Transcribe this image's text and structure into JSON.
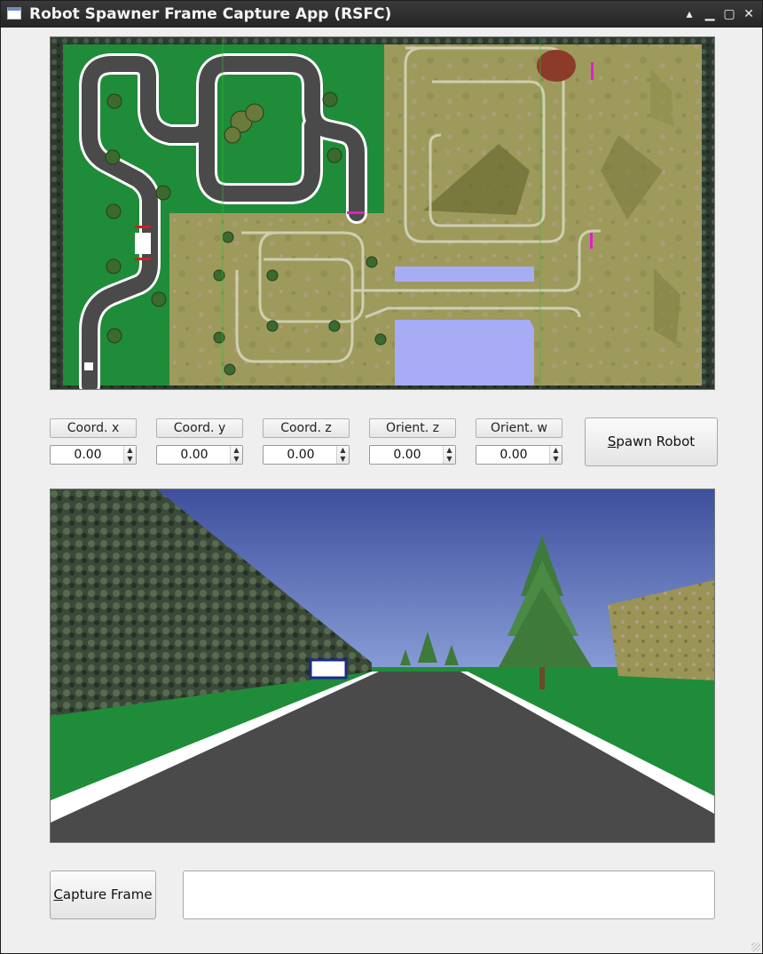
{
  "window": {
    "title": "Robot Spawner Frame Capture App (RSFC)",
    "controls": {
      "minimize": "▁",
      "maximize": "▢",
      "close": "✕",
      "up": "▴"
    }
  },
  "views": {
    "top_view_name": "top-down simulation map",
    "camera_view_name": "robot front camera view"
  },
  "fields": [
    {
      "label": "Coord. x",
      "value": "0.00"
    },
    {
      "label": "Coord. y",
      "value": "0.00"
    },
    {
      "label": "Coord. z",
      "value": "0.00"
    },
    {
      "label": "Orient. z",
      "value": "0.00"
    },
    {
      "label": "Orient. w",
      "value": "0.00"
    }
  ],
  "spawn_button": {
    "mnemonic": "S",
    "rest": "pawn Robot"
  },
  "capture_button": {
    "mnemonic": "C",
    "rest": "apture Frame"
  },
  "status": {
    "value": ""
  },
  "colors": {
    "grass": "#1f8c3a",
    "terrain": "#9a9a58",
    "road": "#4a4a4a",
    "sky_top": "#3e4f9c",
    "sky_bottom": "#8a9fd8",
    "water": "#a8acf5",
    "accent_magenta": "#e020c8"
  }
}
